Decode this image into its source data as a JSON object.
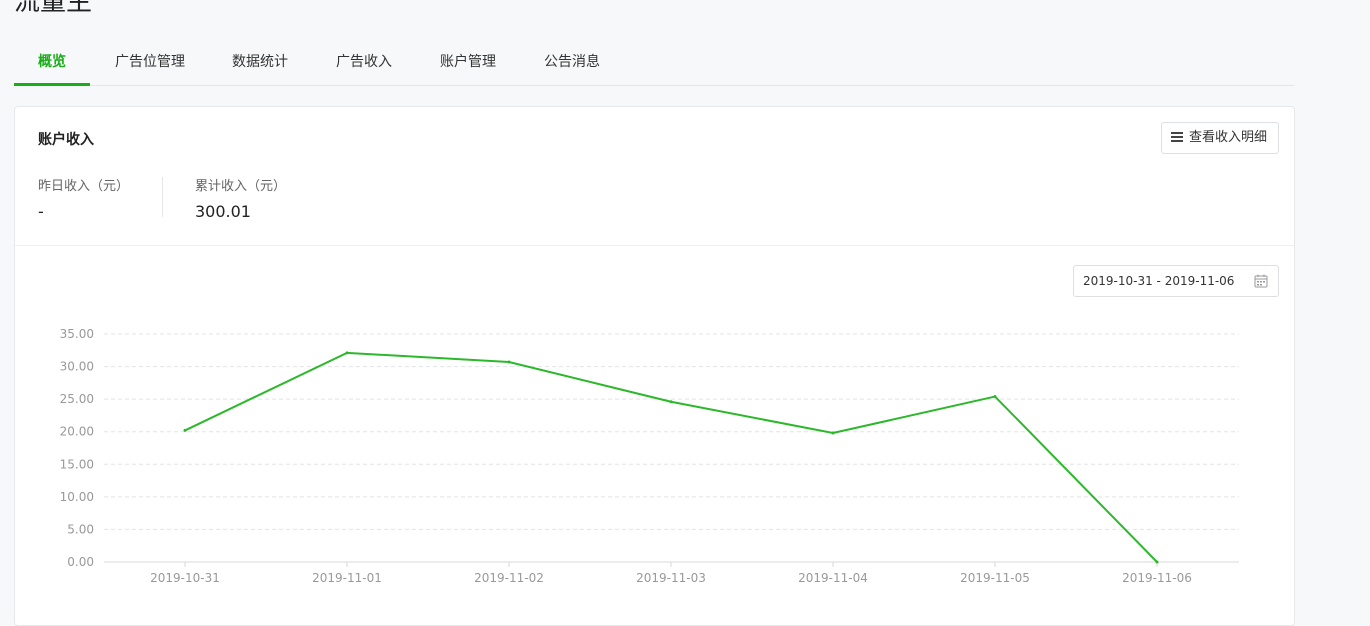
{
  "page": {
    "title": "流量主"
  },
  "tabs": [
    {
      "label": "概览",
      "active": true
    },
    {
      "label": "广告位管理",
      "active": false
    },
    {
      "label": "数据统计",
      "active": false
    },
    {
      "label": "广告收入",
      "active": false
    },
    {
      "label": "账户管理",
      "active": false
    },
    {
      "label": "公告消息",
      "active": false
    }
  ],
  "income": {
    "title": "账户收入",
    "detail_button": "查看收入明细",
    "yesterday_label": "昨日收入（元）",
    "yesterday_value": "-",
    "total_label": "累计收入（元）",
    "total_value": "300.01"
  },
  "date_range": "2019-10-31 - 2019-11-06",
  "colors": {
    "accent": "#1aad19",
    "line": "#2bb82a"
  },
  "chart_data": {
    "type": "line",
    "x": [
      "2019-10-31",
      "2019-11-01",
      "2019-11-02",
      "2019-11-03",
      "2019-11-04",
      "2019-11-05",
      "2019-11-06"
    ],
    "series": [
      {
        "values": [
          20.2,
          32.1,
          30.7,
          24.6,
          19.8,
          25.4,
          0.0
        ]
      }
    ],
    "ylim": [
      0,
      35
    ],
    "yticks": [
      "0.00",
      "5.00",
      "10.00",
      "15.00",
      "20.00",
      "25.00",
      "30.00",
      "35.00"
    ],
    "grid": true
  }
}
